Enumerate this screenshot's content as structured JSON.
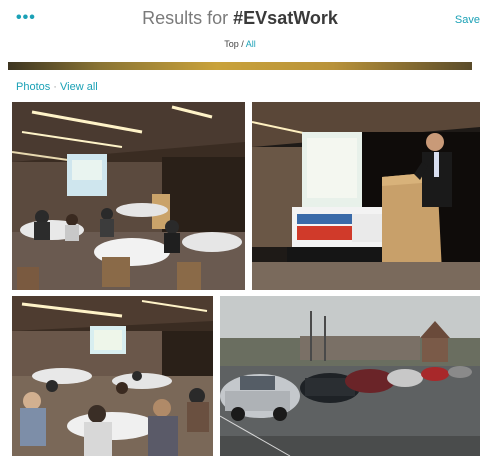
{
  "header": {
    "more_icon": "more-dots-icon",
    "title_prefix": "Results for ",
    "hashtag": "#EVsatWork",
    "filter_top": "Top",
    "filter_sep": " / ",
    "filter_all": "All",
    "save_label": "Save"
  },
  "photos_section": {
    "label": "Photos",
    "separator": " · ",
    "view_all": "View all",
    "items": [
      {
        "depicts": "conference ballroom with audience at round tables and projection screen"
      },
      {
        "depicts": "speaker at wooden podium with banner table"
      },
      {
        "depicts": "audience seated at tables in conference hall"
      },
      {
        "depicts": "parking lot with electric cars on a rainy day"
      }
    ]
  },
  "colors": {
    "accent": "#1ba1b6",
    "title": "#7a7a7a",
    "hashtag": "#3a3a3a"
  }
}
